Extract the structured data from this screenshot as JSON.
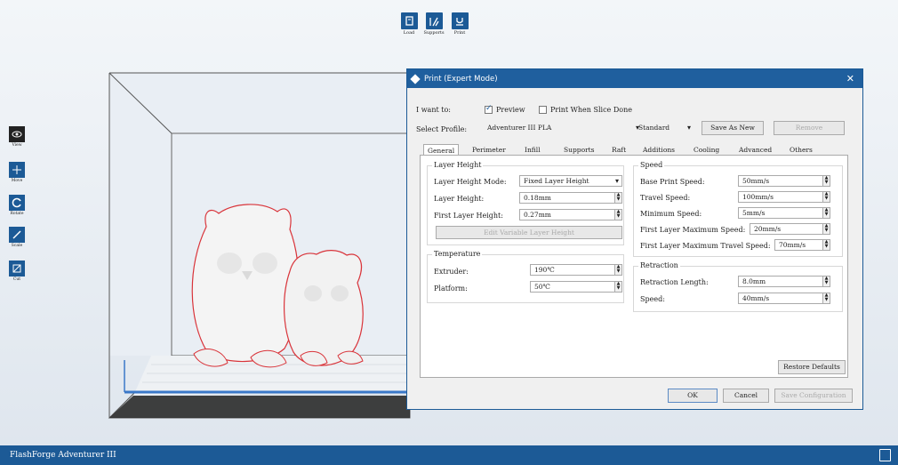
{
  "app": {
    "status_text": "FlashForge Adventurer III"
  },
  "toolbar": {
    "load": "Load",
    "supports": "Supports",
    "print": "Print"
  },
  "left_tools": {
    "view": "View",
    "move": "Move",
    "rotate": "Rotate",
    "scale": "Scale",
    "cut": "Cut"
  },
  "dialog": {
    "title": "Print (Expert Mode)",
    "i_want_to": "I want to:",
    "preview": "Preview",
    "preview_checked": true,
    "print_when_done": "Print When Slice Done",
    "print_when_done_checked": false,
    "select_profile_label": "Select Profile:",
    "profile_value": "Adventurer III PLA",
    "quality_value": "Standard",
    "save_as_new": "Save As New",
    "remove": "Remove",
    "tabs": [
      "General",
      "Perimeter",
      "Infill",
      "Supports",
      "Raft",
      "Additions",
      "Cooling",
      "Advanced",
      "Others"
    ],
    "layer": {
      "heading": "Layer Height",
      "mode_label": "Layer Height Mode:",
      "mode_value": "Fixed Layer Height",
      "height_label": "Layer Height:",
      "height_value": "0.18mm",
      "first_label": "First Layer Height:",
      "first_value": "0.27mm",
      "edit_button": "Edit Variable Layer Height"
    },
    "temperature": {
      "heading": "Temperature",
      "extruder_label": "Extruder:",
      "extruder_value": "190℃",
      "platform_label": "Platform:",
      "platform_value": "50℃"
    },
    "speed": {
      "heading": "Speed",
      "base_label": "Base Print Speed:",
      "base_value": "50mm/s",
      "travel_label": "Travel Speed:",
      "travel_value": "100mm/s",
      "min_label": "Minimum Speed:",
      "min_value": "5mm/s",
      "flmax_label": "First Layer Maximum Speed:",
      "flmax_value": "20mm/s",
      "fltravel_label": "First Layer Maximum Travel Speed:",
      "fltravel_value": "70mm/s"
    },
    "retraction": {
      "heading": "Retraction",
      "length_label": "Retraction Length:",
      "length_value": "8.0mm",
      "speed_label": "Speed:",
      "speed_value": "40mm/s"
    },
    "restore": "Restore Defaults",
    "ok": "OK",
    "cancel": "Cancel",
    "save_config": "Save Configuration"
  },
  "colors": {
    "accent": "#1c5a96",
    "dialog_title": "#1f5f9e",
    "model_outline": "#d9343a",
    "grid_axis": "#3a78c8"
  }
}
